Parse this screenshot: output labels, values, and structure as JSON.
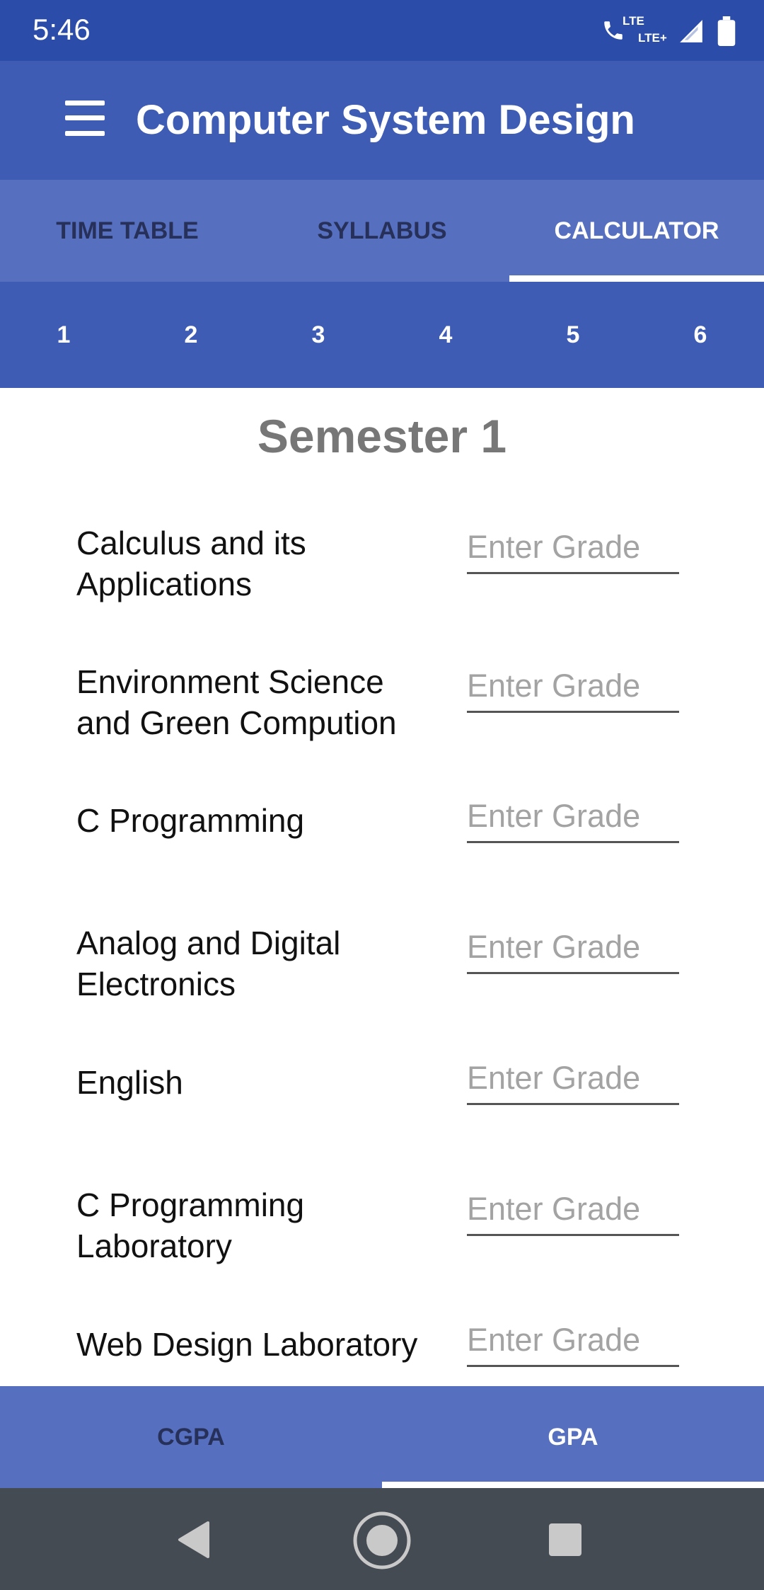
{
  "status_bar": {
    "time": "5:46",
    "lte_top": "LTE",
    "lte_bottom": "LTE+",
    "icons": [
      "call-icon",
      "signal-icon",
      "battery-icon"
    ]
  },
  "app_bar": {
    "title": "Computer System Design",
    "menu_icon": "hamburger-menu-icon"
  },
  "top_tabs": [
    {
      "label": "TIME TABLE",
      "active": false
    },
    {
      "label": "SYLLABUS",
      "active": false
    },
    {
      "label": "CALCULATOR",
      "active": true
    }
  ],
  "semester_tabs": [
    "1",
    "2",
    "3",
    "4",
    "5",
    "6"
  ],
  "semester": {
    "title": "Semester 1",
    "grade_placeholder": "Enter Grade",
    "subjects": [
      "Calculus and its Applications",
      "Environment Science and Green Compution",
      "C Programming",
      "Analog and Digital Electronics",
      "English",
      "C Programming Laboratory",
      "Web Design Laboratory"
    ]
  },
  "bottom_tabs": [
    {
      "label": "CGPA",
      "active": false
    },
    {
      "label": "GPA",
      "active": true
    }
  ],
  "colors": {
    "status_bar": "#2b4ca8",
    "app_bar": "#3f5cb5",
    "tab_bar": "#566fbf",
    "nav_bar": "#454b52"
  }
}
